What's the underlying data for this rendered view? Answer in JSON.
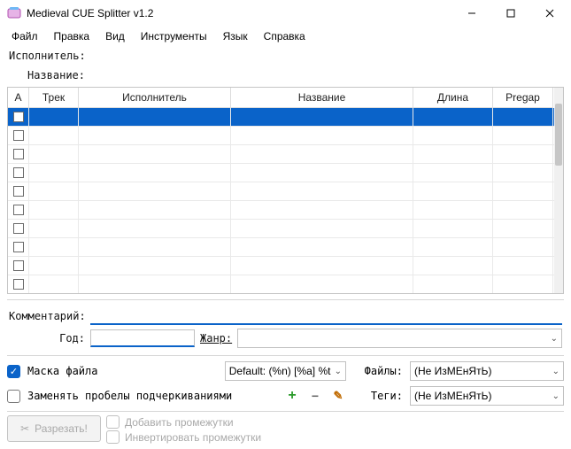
{
  "window": {
    "title": "Medieval CUE Splitter v1.2"
  },
  "menus": {
    "file": "Файл",
    "edit": "Правка",
    "view": "Вид",
    "tools": "Инструменты",
    "lang": "Язык",
    "help": "Справка"
  },
  "header": {
    "performer_label": "Исполнитель:",
    "title_label": "Название:",
    "performer_value": "",
    "title_value": ""
  },
  "table": {
    "cols": {
      "a": "A",
      "track": "Трек",
      "performer": "Исполнитель",
      "title": "Название",
      "length": "Длина",
      "pregap": "Pregap"
    }
  },
  "comment": {
    "label": "Комментарий:",
    "value": ""
  },
  "year": {
    "label": "Год:",
    "value": ""
  },
  "genre": {
    "label": "Жанр:",
    "value": ""
  },
  "options": {
    "mask_label": "Маска файла",
    "mask_value": "Default: (%n) [%a] %t",
    "replace_spaces_label": "Заменять пробелы подчеркиваниями",
    "files_label": "Файлы:",
    "files_value": "(Не ИзМЕнЯтЬ)",
    "tags_label": "Теги:",
    "tags_value": "(Не ИзМЕнЯтЬ)"
  },
  "footer": {
    "cut_label": "Разрезать!",
    "add_gaps_label": "Добавить промежутки",
    "invert_gaps_label": "Инвертировать промежутки"
  }
}
